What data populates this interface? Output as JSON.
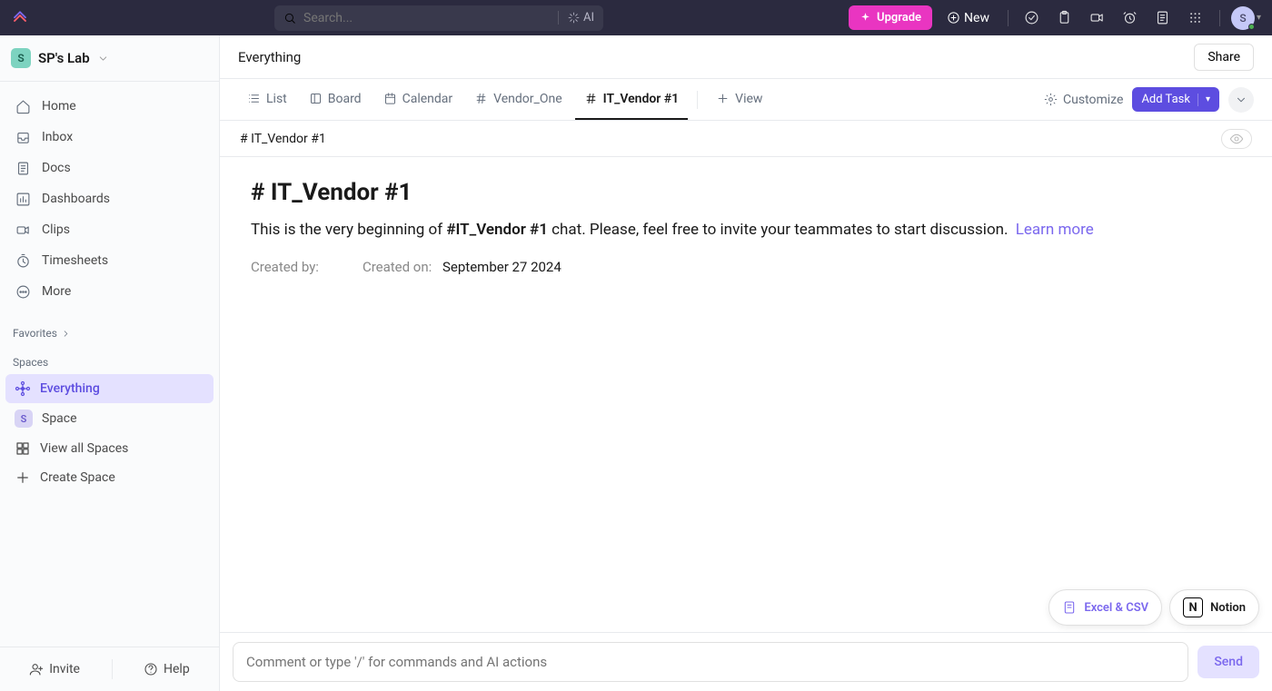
{
  "topbar": {
    "search_placeholder": "Search...",
    "ai_label": "AI",
    "upgrade_label": "Upgrade",
    "new_label": "New",
    "avatar_initial": "S"
  },
  "sidebar": {
    "workspace": {
      "initial": "S",
      "name": "SP's Lab"
    },
    "nav": [
      {
        "label": "Home"
      },
      {
        "label": "Inbox"
      },
      {
        "label": "Docs"
      },
      {
        "label": "Dashboards"
      },
      {
        "label": "Clips"
      },
      {
        "label": "Timesheets"
      },
      {
        "label": "More"
      }
    ],
    "favorites_label": "Favorites",
    "spaces_label": "Spaces",
    "spaces": [
      {
        "label": "Everything",
        "active": true
      },
      {
        "label": "Space",
        "initial": "S"
      },
      {
        "label": "View all Spaces"
      },
      {
        "label": "Create Space"
      }
    ],
    "invite_label": "Invite",
    "help_label": "Help"
  },
  "header": {
    "breadcrumb": "Everything",
    "share_label": "Share"
  },
  "tabs": [
    {
      "label": "List"
    },
    {
      "label": "Board"
    },
    {
      "label": "Calendar"
    },
    {
      "label": "Vendor_One"
    },
    {
      "label": "IT_Vendor #1",
      "active": true
    },
    {
      "label": "View"
    }
  ],
  "tabs_right": {
    "customize_label": "Customize",
    "add_task_label": "Add Task"
  },
  "channel": {
    "title_small": "# IT_Vendor #1",
    "heading": "# IT_Vendor #1",
    "intro_prefix": "This is the very beginning of ",
    "intro_bold": "#IT_Vendor #1",
    "intro_suffix": " chat. Please, feel free to invite your teammates to start discussion.",
    "learn_more": "Learn more",
    "created_by_label": "Created by:",
    "created_by_value": "",
    "created_on_label": "Created on:",
    "created_on_value": "September 27 2024"
  },
  "chips": {
    "excel_label": "Excel & CSV",
    "notion_label": "Notion",
    "notion_initial": "N"
  },
  "composer": {
    "placeholder": "Comment or type '/' for commands and AI actions",
    "send_label": "Send"
  }
}
